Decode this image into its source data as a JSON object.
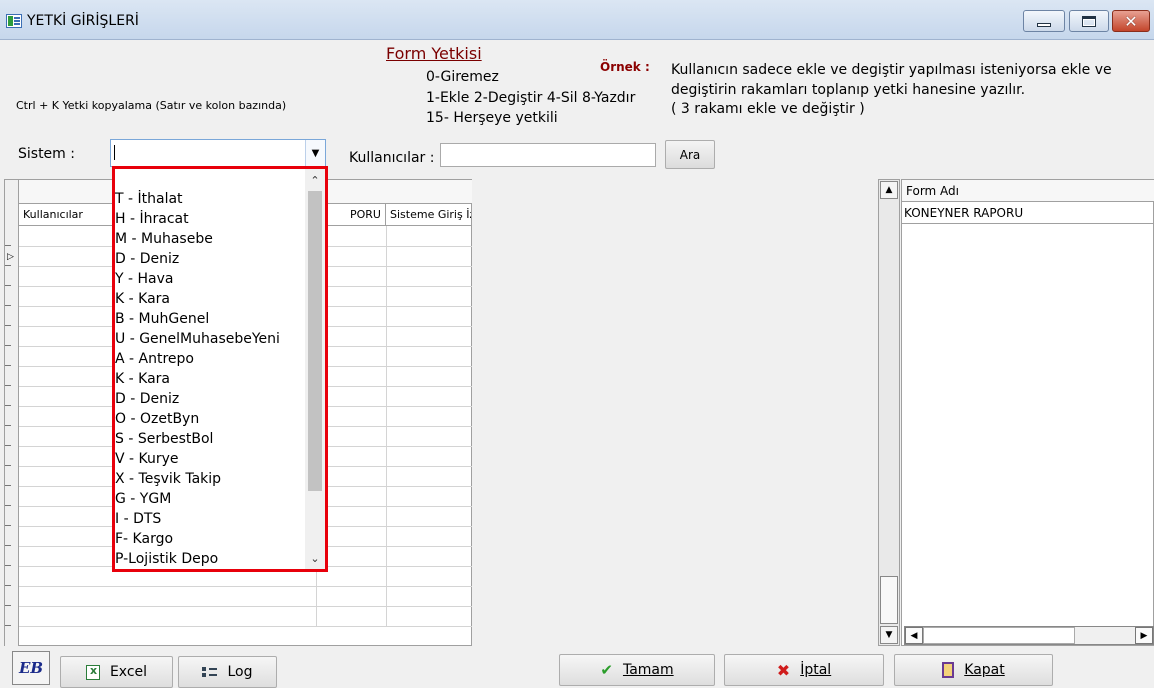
{
  "window": {
    "title": "YETKİ GİRİŞLERİ",
    "close_glyph": "✕"
  },
  "header": {
    "ctrl_hint": "Ctrl + K Yetki kopyalama (Satır ve kolon bazında)",
    "form_yetkisi": "Form Yetkisi",
    "perm_line1": "0-Giremez",
    "perm_line2": "1-Ekle  2-Degiştir  4-Sil  8-Yazdır",
    "perm_line3": "15- Herşeye yetkili",
    "ornek_label": "Örnek :",
    "example_line1": "Kullanıcın sadece ekle ve degiştir yapılması isteniyorsa  ekle ve",
    "example_line2": "degiştirin rakamları toplanıp yetki hanesine yazılır.",
    "example_line3": " ( 3 rakamı ekle ve değiştir )"
  },
  "filters": {
    "sistem_label": "Sistem :",
    "sistem_value": "",
    "kullanicilar_label": "Kullanıcılar :",
    "kullanicilar_value": "",
    "ara_label": "Ara"
  },
  "dropdown": {
    "items": [
      "T - İthalat",
      "H - İhracat",
      "M - Muhasebe",
      "D - Deniz",
      "Y - Hava",
      "K - Kara",
      "B - MuhGenel",
      "U - GenelMuhasebeYeni",
      "A - Antrepo",
      "K - Kara",
      "D - Deniz",
      "O - OzetByn",
      "S - SerbestBol",
      "V - Kurye",
      "X - Teşvik Takip",
      "G - YGM",
      "I - DTS",
      "F- Kargo",
      "P-Lojistik Depo"
    ]
  },
  "grid": {
    "col_kullanicilar": "Kullanıcılar",
    "col_raporu": "PORU",
    "col_giris": "Sisteme Giriş İzni"
  },
  "form_panel": {
    "header": "Form Adı",
    "rows": [
      "KONEYNER RAPORU"
    ]
  },
  "bottom": {
    "logo_text": "EB",
    "excel_label": "Excel",
    "log_label": "Log",
    "tamam_label": "Tamam",
    "iptal_label": "İptal",
    "kapat_label": "Kapat"
  },
  "colors": {
    "highlight_border": "#e8000b",
    "form_title": "#7a0000"
  }
}
